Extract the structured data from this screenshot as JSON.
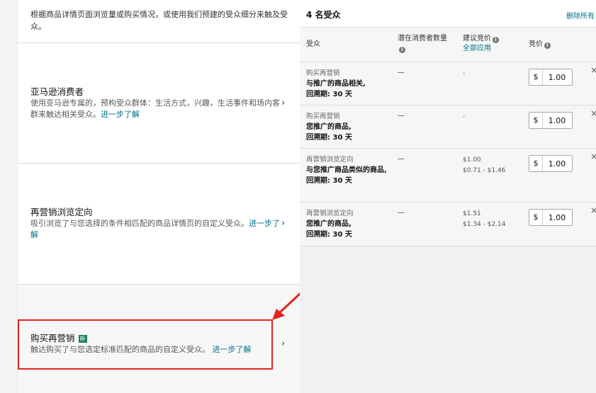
{
  "left": {
    "intro": "根据商品详情页面浏览量或购买情况，或使用我们预建的受众细分来触及受众。",
    "options": [
      {
        "title": "亚马逊消费者",
        "desc": "使用亚马逊专属的，预构受众群体：生活方式，兴趣，生活事件和场内客群来触达相关受众。",
        "link": "进一步了解"
      },
      {
        "title": "再营销浏览定向",
        "desc": "吸引浏览了与您选择的条件相匹配的商品详情页的自定义受众。",
        "link": "进一步了解"
      },
      {
        "title": "购买再营销",
        "badge": "新",
        "desc": "触达购买了与您选定标准匹配的商品的自定义受众。",
        "link": "进一步了解"
      }
    ],
    "chevron": "›"
  },
  "right": {
    "title": "4 名受众",
    "remove_all": "删除所有",
    "headers": {
      "audience": "受众",
      "potential": "潜在消费者数量",
      "suggested": "建议竞价",
      "apply_all": "全部应用",
      "bid": "竞价",
      "info_glyph": "i"
    },
    "rows": [
      {
        "type": "购买再营销",
        "desc": "与推广的商品相关,",
        "lookback": "回溯期: 30 天",
        "potential": "—",
        "sugg": "-",
        "range": "",
        "currency": "$",
        "bid": "1.00"
      },
      {
        "type": "购买再营销",
        "desc": "您推广的商品,",
        "lookback": "回溯期: 30 天",
        "potential": "—",
        "sugg": "-",
        "range": "",
        "currency": "$",
        "bid": "1.00"
      },
      {
        "type": "再营销浏览定向",
        "desc": "与您推广商品类似的商品,",
        "lookback": "回溯期: 30 天",
        "potential": "—",
        "sugg": "$1.00",
        "range": "$0.71 - $1.46",
        "currency": "$",
        "bid": "1.00"
      },
      {
        "type": "再营销浏览定向",
        "desc": "您推广的商品,",
        "lookback": "回溯期: 30 天",
        "potential": "—",
        "sugg": "$1.51",
        "range": "$1.34 - $2.14",
        "currency": "$",
        "bid": "1.00"
      }
    ],
    "remove_glyph": "×"
  },
  "colors": {
    "link": "#007185",
    "highlight": "#e3241b",
    "badge": "#1a7b5e"
  }
}
